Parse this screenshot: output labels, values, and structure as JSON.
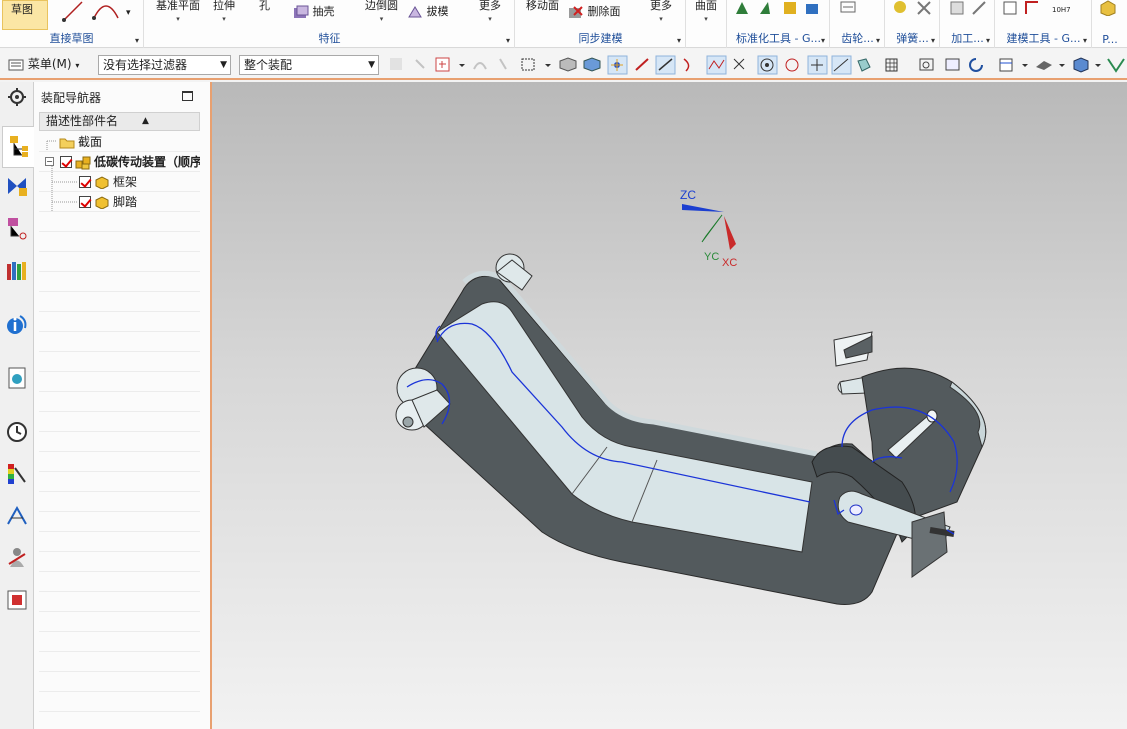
{
  "ribbon": {
    "groups": [
      {
        "label": "直接草图",
        "buttons": [
          "草图"
        ]
      },
      {
        "label": "特征",
        "buttons": [
          "基准平面",
          "拉伸",
          "孔",
          "抽壳",
          "边倒圆",
          "拔模",
          "更多"
        ]
      },
      {
        "label": "同步建模",
        "buttons": [
          "移动面",
          "删除面",
          "更多"
        ]
      },
      {
        "label": "标准化工具 - G...",
        "buttons": [
          "曲面"
        ]
      },
      {
        "label": "齿轮...",
        "buttons": []
      },
      {
        "label": "弹簧...",
        "buttons": []
      },
      {
        "label": "加工...",
        "buttons": []
      },
      {
        "label": "建模工具 - G...",
        "buttons": [
          "10H7"
        ]
      },
      {
        "label": "P...",
        "buttons": []
      }
    ]
  },
  "cmdbar": {
    "menu_label": "菜单(M)",
    "filter_value": "没有选择过滤器",
    "scope_value": "整个装配"
  },
  "navigator": {
    "title": "装配导航器",
    "column_header": "描述性部件名",
    "tree": [
      {
        "label": "截面",
        "level": 1,
        "checked": false,
        "kind": "folder"
      },
      {
        "label": "低碳传动装置（顺序",
        "level": 1,
        "checked": true,
        "kind": "assembly",
        "bold": true
      },
      {
        "label": "框架",
        "level": 2,
        "checked": true,
        "kind": "part"
      },
      {
        "label": "脚踏",
        "level": 2,
        "checked": true,
        "kind": "part"
      }
    ]
  },
  "viewport": {
    "triad": {
      "z": "ZC",
      "y": "YC",
      "x": "XC"
    },
    "colors": {
      "model_dark": "#535a5d",
      "model_light": "#d8e4e7",
      "sketch_line": "#1b34d8",
      "accent": "#e8a070"
    }
  }
}
